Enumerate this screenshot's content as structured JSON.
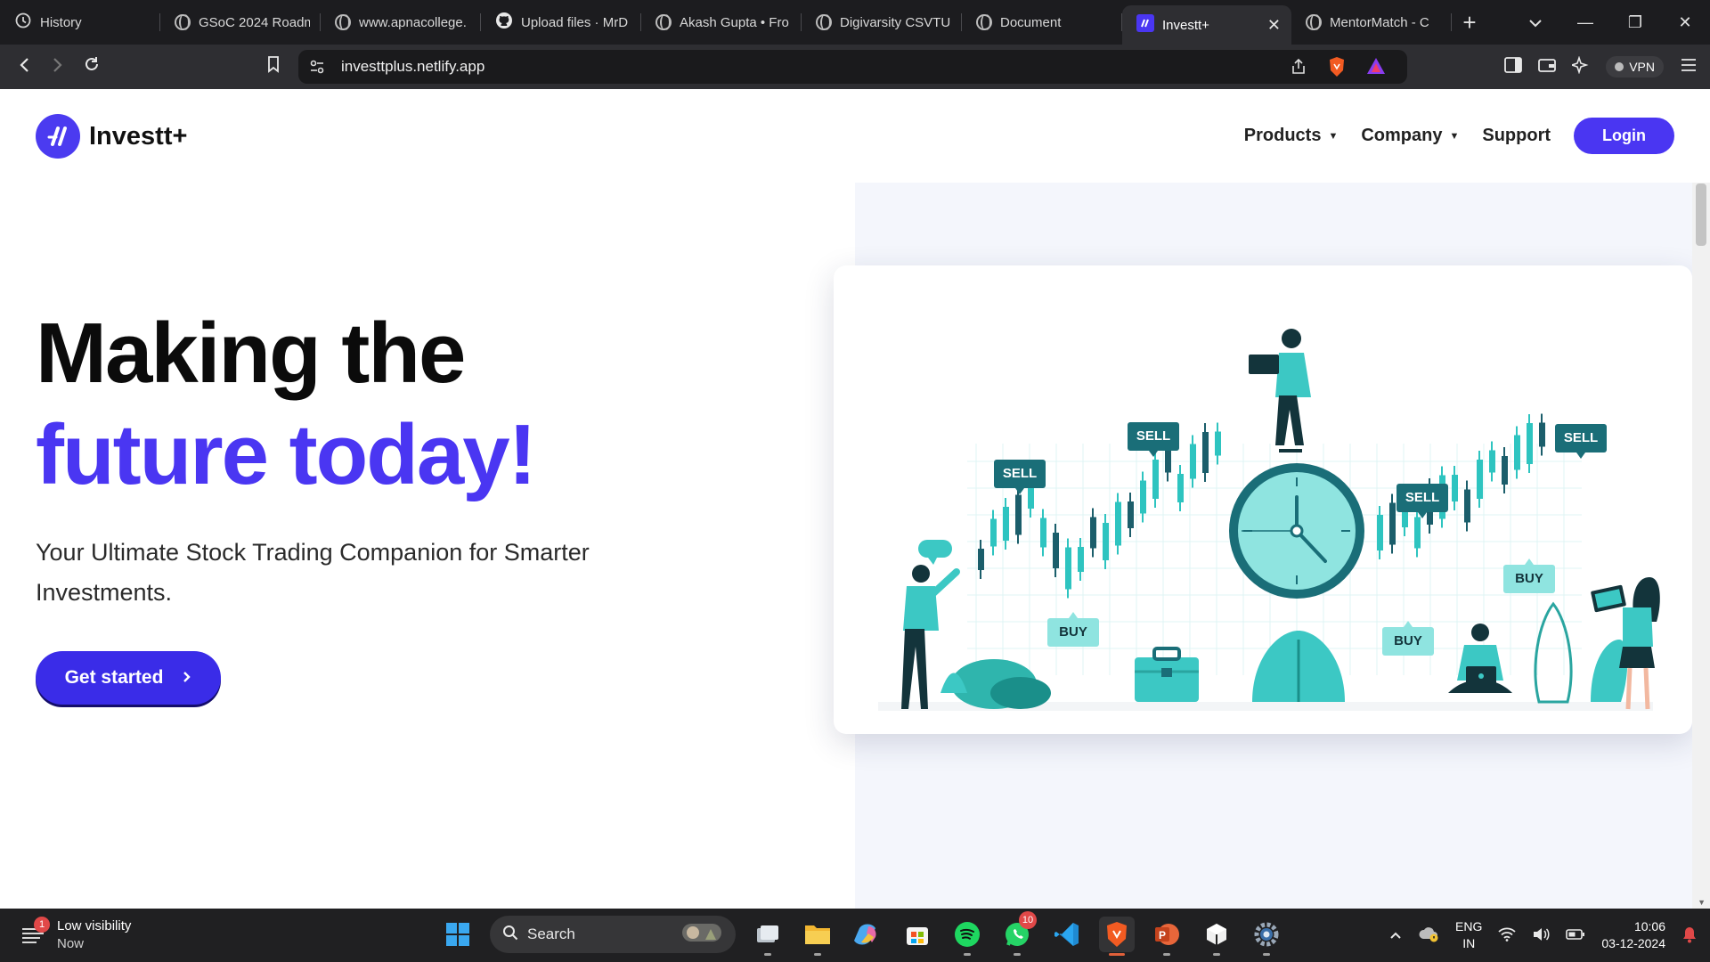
{
  "browser": {
    "tabs": [
      {
        "label": "History",
        "icon": "history-icon"
      },
      {
        "label": "GSoC 2024 Roadm",
        "icon": "globe-icon"
      },
      {
        "label": "www.apnacollege.",
        "icon": "globe-icon"
      },
      {
        "label": "Upload files · MrD",
        "icon": "github-icon"
      },
      {
        "label": "Akash Gupta • Fro",
        "icon": "globe-icon"
      },
      {
        "label": "Digivarsity CSVTU",
        "icon": "globe-icon"
      },
      {
        "label": "Document",
        "icon": "globe-icon"
      },
      {
        "label": "Investt+",
        "icon": "investt-favicon",
        "active": true
      },
      {
        "label": "MentorMatch - C",
        "icon": "globe-icon"
      }
    ],
    "url": "investtplus.netlify.app",
    "vpn_label": "VPN"
  },
  "site": {
    "brand": "Investt+",
    "nav": {
      "products": "Products",
      "company": "Company",
      "support": "Support",
      "login": "Login"
    },
    "hero": {
      "title_line1": "Making the",
      "title_line2": "future today!",
      "subtitle": "Your Ultimate Stock Trading Companion for Smarter Investments.",
      "cta": "Get started"
    },
    "illustration": {
      "tags": [
        "SELL",
        "SELL",
        "SELL",
        "SELL",
        "BUY",
        "BUY",
        "BUY"
      ]
    }
  },
  "taskbar": {
    "weather_title": "Low visibility",
    "weather_sub": "Now",
    "weather_badge": "1",
    "search_placeholder": "Search",
    "whatsapp_badge": "10",
    "lang_line1": "ENG",
    "lang_line2": "IN",
    "time": "10:06",
    "date": "03-12-2024"
  },
  "colors": {
    "accent": "#4a36f2",
    "teal": "#2ec4c0",
    "dark_teal": "#1b5e6b"
  }
}
